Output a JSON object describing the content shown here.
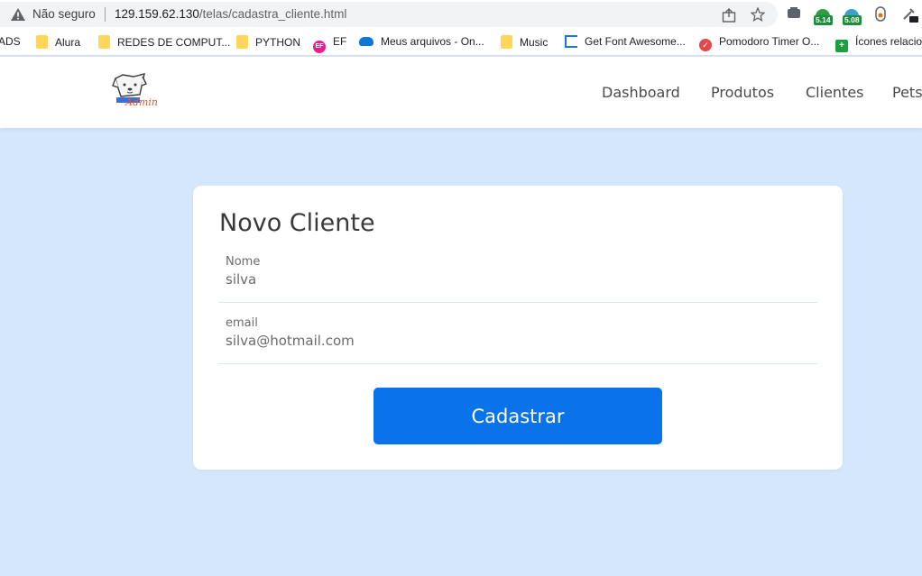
{
  "browser": {
    "security_label": "Não seguro",
    "url_host": "129.159.62.130",
    "url_path": "/telas/cadastra_cliente.html",
    "extensions": [
      {
        "name": "extension-1",
        "badge": ""
      },
      {
        "name": "extension-2",
        "badge": "5.14",
        "badge_color": "#1e8e3e"
      },
      {
        "name": "extension-3",
        "badge": "5.08",
        "badge_color": "#1e8e3e"
      }
    ]
  },
  "bookmarks": [
    {
      "label": "ADS",
      "icon": "none"
    },
    {
      "label": "Alura",
      "icon": "folder-icon"
    },
    {
      "label": "REDES DE COMPUT...",
      "icon": "folder-icon"
    },
    {
      "label": "PYTHON",
      "icon": "folder-icon"
    },
    {
      "label": "EF",
      "icon": "ef-icon"
    },
    {
      "label": "Meus arquivos - On...",
      "icon": "onedrive-icon"
    },
    {
      "label": "Music",
      "icon": "folder-icon"
    },
    {
      "label": "Get Font Awesome...",
      "icon": "flag-icon"
    },
    {
      "label": "Pomodoro Timer O...",
      "icon": "pomodoro-icon"
    },
    {
      "label": "Ícones relacio",
      "icon": "grid-icon"
    }
  ],
  "site": {
    "nav": [
      "Dashboard",
      "Produtos",
      "Clientes",
      "Pets"
    ],
    "logo_text": "Admin"
  },
  "form": {
    "title": "Novo Cliente",
    "fields": [
      {
        "label": "Nome",
        "value": "silva"
      },
      {
        "label": "email",
        "value": "silva@hotmail.com"
      }
    ],
    "submit_label": "Cadastrar"
  },
  "colors": {
    "page_bg": "#d4e7fc",
    "button_bg": "#0a73ea"
  }
}
